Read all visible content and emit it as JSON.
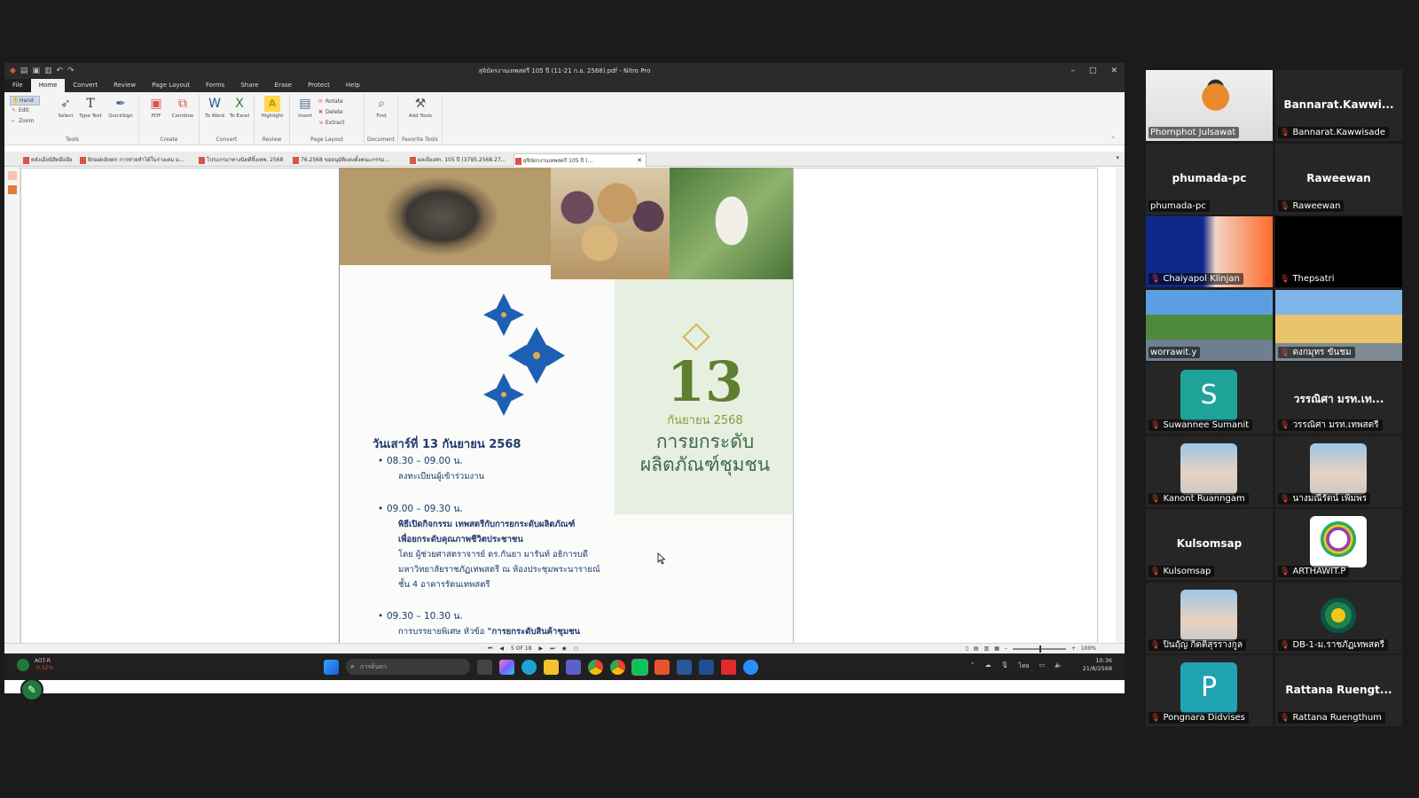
{
  "app": {
    "window_title": "สุจิบัตรงานเทพสตรี 105 ปี (11-21 ก.ย. 2568).pdf - Nitro Pro",
    "menu_tabs": [
      "File",
      "Home",
      "Convert",
      "Review",
      "Page Layout",
      "Forms",
      "Share",
      "Erase",
      "Protect",
      "Help"
    ],
    "active_tab": "Home"
  },
  "ribbon": {
    "tools": {
      "hand": "Hand",
      "edit": "Edit",
      "zoom": "Zoom",
      "select": "Select",
      "type_text": "Type Text",
      "quicksign": "QuickSign",
      "label": "Tools"
    },
    "create": {
      "pdf": "PDF",
      "combine": "Combine",
      "label": "Create"
    },
    "convert": {
      "to_word": "To Word",
      "to_excel": "To Excel",
      "label": "Convert"
    },
    "review": {
      "highlight": "Highlight",
      "label": "Review"
    },
    "page_layout": {
      "insert": "Insert",
      "rotate": "Rotate",
      "delete": "Delete",
      "extract": "Extract",
      "label": "Page Layout"
    },
    "document": {
      "find": "Find",
      "label": "Document"
    },
    "favorite": {
      "add_tools": "Add Tools",
      "label": "Favorite Tools"
    }
  },
  "doc_tabs": [
    "คลังเมียนิสิตมืออีย",
    "Breakdown การท่ายทำได้ในร่างเดม ม...",
    "โปรแกรมาทางนิตดีหิ้งเทพ. 2568",
    "76.2568 ขออนุมัติแต่งตั้งคณะกรรม...",
    "ผลเยี่ยงสก. 105 ปี (3795.2568.27...",
    "สุจิบัตรงานเทพสตรี 105 ปี (..."
  ],
  "pdf_page": {
    "day": "13",
    "month": "กันยายน 2568",
    "panel_title_1": "การยกระดับ",
    "panel_title_2": "ผลิตภัณฑ์ชุมชน",
    "date_heading": "วันเสาร์ที่ 13 กันยายน 2568",
    "items": [
      {
        "time": "08.30 – 09.00 น.",
        "detail": "ลงทะเบียนผู้เข้าร่วมงาน"
      },
      {
        "time": "09.00 – 09.30 น.",
        "bold1": "พิธีเปิดกิจกรรม เทพสตรีกับการยกระดับผลิตภัณฑ์",
        "bold2": "เพื่อยกระดับคุณภาพชีวิตประชาชน",
        "d1": "โดย ผู้ช่วยศาสตราจารย์ ดร.กันยา มารันท์ อธิการบดี",
        "d2": "มหาวิทยาลัยราชภัฏเทพสตรี ณ ห้องประชุมพระนารายณ์",
        "d3": "ชั้น 4 อาคารรัตนเทพสตรี"
      },
      {
        "time": "09.30 – 10.30 น.",
        "d1": "การบรรยายพิเศษ หัวข้อ ",
        "bold1": "\"การยกระดับสินค้าชุมชน"
      }
    ]
  },
  "status": {
    "page_indicator": "5 OF 18",
    "zoom": "100%"
  },
  "taskbar": {
    "left_app": "AOT-R",
    "left_sub": "-0.32%",
    "search_placeholder": "การค้นหา",
    "language": "ไทย",
    "time": "10:36",
    "date": "21/8/2568"
  },
  "participants": [
    {
      "label": "Phornphot Julsawat",
      "kind": "video",
      "speaking": true,
      "muted": false
    },
    {
      "label": "Bannarat.Kawwisade",
      "big": "Bannarat.Kawwi...",
      "kind": "name",
      "muted": true
    },
    {
      "label": "phumada-pc",
      "big": "phumada-pc",
      "kind": "name",
      "muted": false
    },
    {
      "label": "Raweewan",
      "big": "Raweewan",
      "kind": "name",
      "muted": true
    },
    {
      "label": "Chaiyapol Klinjan",
      "kind": "video",
      "muted": true
    },
    {
      "label": "Thepsatri",
      "kind": "black",
      "muted": true
    },
    {
      "label": "worrawit.y",
      "kind": "video",
      "muted": false
    },
    {
      "label": "ดงกมุทร ขันชม",
      "kind": "video",
      "muted": true
    },
    {
      "label": "Suwannee Sumanit",
      "kind": "avatar",
      "letter": "S",
      "color": "#1fa398",
      "muted": true
    },
    {
      "label": "วรรณิศา มรท.เทพสตรี",
      "big": "วรรณิศา มรท.เท...",
      "kind": "name",
      "muted": true
    },
    {
      "label": "Kanont Ruanngam",
      "kind": "photo",
      "muted": true
    },
    {
      "label": "นางมณีรัตน์ เพิ่มพร",
      "kind": "photo",
      "muted": true
    },
    {
      "label": "Kulsomsap",
      "big": "Kulsomsap",
      "kind": "name",
      "muted": true
    },
    {
      "label": "ARTHAWIT.P",
      "kind": "logo",
      "muted": true
    },
    {
      "label": "ปิ่นฤัญ กิตติสุรรางกูล",
      "kind": "photo",
      "muted": true
    },
    {
      "label": "DB-1-ม.ราชภัฏเทพสตรี",
      "kind": "logo2",
      "muted": true
    },
    {
      "label": "Pongnara Didvises",
      "kind": "avatar",
      "letter": "P",
      "color": "#1fa3b3",
      "muted": true
    },
    {
      "label": "Rattana Ruengthum",
      "big": "Rattana Ruengt...",
      "kind": "name",
      "muted": true
    }
  ],
  "colors": {
    "accent_green": "#33d17a",
    "mute_red": "#e2453c",
    "nitro_red": "#d9534f"
  }
}
